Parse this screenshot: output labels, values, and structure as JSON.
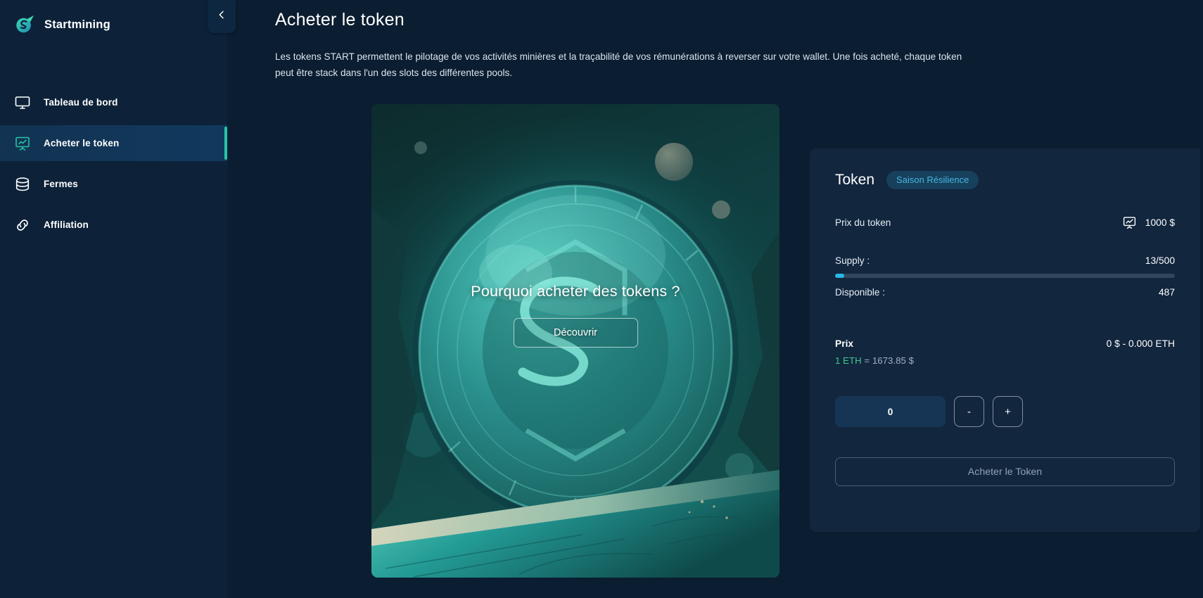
{
  "brand": {
    "name": "Startmining",
    "logo_icon": "startmining-logo-icon"
  },
  "sidebar": {
    "collapse_icon": "chevron-left-icon",
    "items": [
      {
        "label": "Tableau de bord",
        "icon": "monitor-icon",
        "active": false
      },
      {
        "label": "Acheter le token",
        "icon": "presentation-chart-icon",
        "active": true
      },
      {
        "label": "Fermes",
        "icon": "database-icon",
        "active": false
      },
      {
        "label": "Affiliation",
        "icon": "link-chain-icon",
        "active": false
      }
    ]
  },
  "page": {
    "title": "Acheter le token",
    "description": "Les tokens START permettent le pilotage de vos activités minières et la traçabilité de vos rémunérations à reverser sur votre wallet. Une fois acheté, chaque token peut être stack dans l'un des slots des différentes pools."
  },
  "hero": {
    "heading": "Pourquoi acheter des tokens ?",
    "cta_label": "Découvrir",
    "art_name": "token-coin-space-artwork"
  },
  "token_panel": {
    "title": "Token",
    "badge": "Saison Résilience",
    "price_label": "Prix du token",
    "price_value": "1000 $",
    "price_icon": "presentation-chart-icon",
    "supply_label": "Supply :",
    "supply_value": "13/500",
    "supply_percent": 2.6,
    "available_label": "Disponible :",
    "available_value": "487",
    "prix_label": "Prix",
    "prix_value": "0 $ - 0.000 ETH",
    "eth_rate_highlight": "1 ETH",
    "eth_rate_rest": " = 1673.85 $",
    "quantity_value": "0",
    "decrement_label": "-",
    "increment_label": "+",
    "buy_label": "Acheter le Token"
  },
  "colors": {
    "accent_teal": "#27c4a8",
    "accent_cyan": "#29b8e5",
    "badge_text": "#47b6e0",
    "eth_green": "#3ec98e",
    "sidebar_bg": "#0d2239",
    "panel_bg": "#12263e",
    "main_bg": "#0b1d30"
  }
}
